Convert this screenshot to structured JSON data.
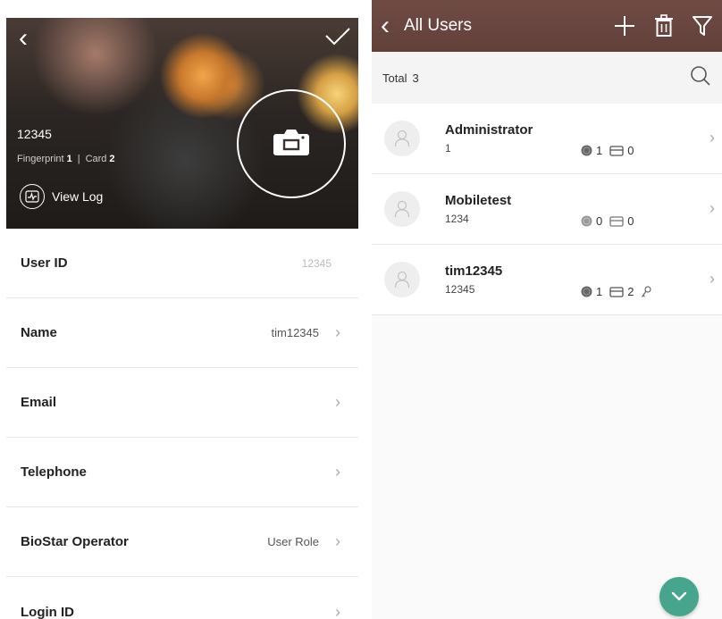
{
  "detail": {
    "user_id_header": "12345",
    "fingerprint_label": "Fingerprint",
    "fingerprint_count": "1",
    "card_label": "Card",
    "card_count": "2",
    "view_log_label": "View Log",
    "fields": [
      {
        "label": "User ID",
        "value": "12345",
        "chevron": false
      },
      {
        "label": "Name",
        "value": "tim12345",
        "chevron": true
      },
      {
        "label": "Email",
        "value": "",
        "chevron": true
      },
      {
        "label": "Telephone",
        "value": "",
        "chevron": true
      },
      {
        "label": "BioStar Operator",
        "value": "User Role",
        "chevron": true
      },
      {
        "label": "Login ID",
        "value": "",
        "chevron": true
      }
    ]
  },
  "list": {
    "title": "All Users",
    "total_label": "Total",
    "total_count": "3",
    "users": [
      {
        "name": "Administrator",
        "id": "1",
        "fingerprints": "1",
        "cards": "0",
        "has_key": false
      },
      {
        "name": "Mobiletest",
        "id": "1234",
        "fingerprints": "0",
        "cards": "0",
        "has_key": false
      },
      {
        "name": "tim12345",
        "id": "12345",
        "fingerprints": "1",
        "cards": "2",
        "has_key": true
      }
    ]
  },
  "colors": {
    "header_bg": "#62403a",
    "fab": "#46a58c"
  }
}
